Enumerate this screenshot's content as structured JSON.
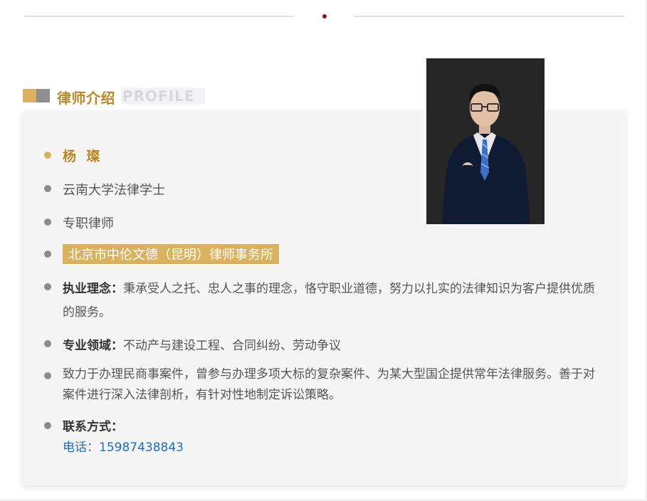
{
  "header": {
    "title": "律师介绍",
    "subtitle": "PROFILE"
  },
  "profile": {
    "name": "杨 璨",
    "education": "云南大学法律学士",
    "position": "专职律师",
    "firm": "北京市中伦文德（昆明）律师事务所",
    "philosophy_label": "执业理念：",
    "philosophy_text": "秉承受人之托、忠人之事的理念，恪守职业道德，努力以扎实的法律知识为客户提供优质的服务。",
    "fields_label": "专业领域：",
    "fields_text": "不动产与建设工程、合同纠纷、劳动争议",
    "experience": "致力于办理民商事案件，曾参与办理多项大标的复杂案件、为某大型国企提供常年法律服务。善于对案件进行深入法律剖析，有针对性地制定诉讼策略。",
    "contact_label": "联系方式：",
    "phone": "电话：15987438843"
  },
  "colors": {
    "accent_gold": "#d9b15f",
    "title_gold": "#b8872a",
    "dot_red": "#9a1111",
    "link_blue": "#1c6fc4"
  }
}
